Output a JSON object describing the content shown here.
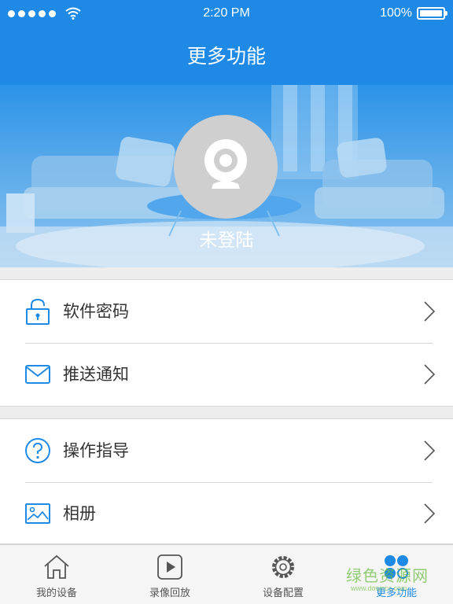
{
  "status_bar": {
    "time": "2:20 PM",
    "battery": "100%",
    "signal_dots": 5
  },
  "nav": {
    "title": "更多功能"
  },
  "profile": {
    "login_status": "未登陆",
    "avatar_icon": "webcam-icon"
  },
  "menu_groups": [
    {
      "items": [
        {
          "label": "软件密码",
          "icon": "lock-icon"
        },
        {
          "label": "推送通知",
          "icon": "mail-icon"
        }
      ]
    },
    {
      "items": [
        {
          "label": "操作指导",
          "icon": "help-icon"
        },
        {
          "label": "相册",
          "icon": "photo-album-icon"
        }
      ]
    }
  ],
  "tabs": [
    {
      "label": "我的设备",
      "icon": "home-icon"
    },
    {
      "label": "录像回放",
      "icon": "play-icon"
    },
    {
      "label": "设备配置",
      "icon": "gear-icon"
    },
    {
      "label": "更多功能",
      "icon": "more-dots-icon",
      "active": true
    }
  ],
  "colors": {
    "primary": "#1f8ae6",
    "tab_active": "#1f8ae6"
  },
  "watermark": {
    "text": "绿色资源网",
    "url": "www.downcc.com"
  }
}
